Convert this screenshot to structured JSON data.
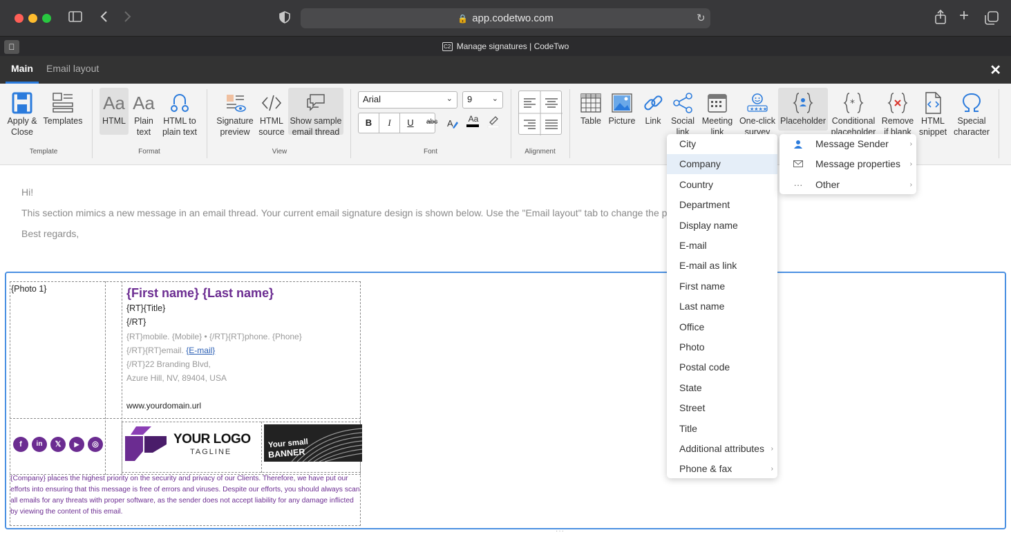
{
  "browser": {
    "url": "app.codetwo.com",
    "tab_title": "Manage signatures | CodeTwo",
    "tab_favicon": "C2"
  },
  "app_tabs": [
    "Main",
    "Email layout"
  ],
  "ribbon": {
    "template": {
      "label": "Template",
      "apply_close": "Apply &\nClose",
      "templates": "Templates"
    },
    "format": {
      "label": "Format",
      "html": "HTML",
      "plain_text": "Plain\ntext",
      "html_to_plain": "HTML to\nplain text"
    },
    "view": {
      "label": "View",
      "signature_preview": "Signature\npreview",
      "html_source": "HTML\nsource",
      "show_sample": "Show sample\nemail thread"
    },
    "font": {
      "label": "Font",
      "family": "Arial",
      "size": "9",
      "bold": "B",
      "italic": "I",
      "underline": "U",
      "strike": "abc",
      "font_color_sample": "Aa"
    },
    "alignment": {
      "label": "Alignment"
    },
    "insert": {
      "table": "Table",
      "picture": "Picture",
      "link": "Link",
      "social_link": "Social\nlink",
      "meeting_link": "Meeting\nlink",
      "one_click_survey": "One-click\nsurvey",
      "placeholder": "Placeholder",
      "conditional_placeholder": "Conditional\nplaceholder",
      "remove_if_blank": "Remove\nif blank",
      "html_snippet": "HTML\nsnippet",
      "special_character": "Special\ncharacter"
    }
  },
  "message": {
    "greeting": "Hi!",
    "body": "This section mimics a new message in an email thread. Your current email signature design is shown below. Use the \"Email layout\" tab to change the po",
    "closing": "Best regards,"
  },
  "signature": {
    "photo": "{Photo 1}",
    "name": "{First name} {Last name}",
    "title": "{RT}{Title}",
    "rt_close": "{/RT}",
    "phones": "{RT}mobile. {Mobile} • {/RT}{RT}phone. {Phone}",
    "email_prefix": "{/RT}{RT}email. ",
    "email_link": "{E-mail}",
    "address1": "{/RT}22 Branding Blvd,",
    "address2": "Azure Hill, NV, 89404, USA",
    "website": "www.yourdomain.url",
    "logo_text": "YOUR LOGO",
    "logo_tagline": "TAGLINE",
    "banner_line1": "Your small",
    "banner_line2": "BANNER",
    "disclaimer": "{Company} places the highest priority on the security and privacy of our Clients. Therefore, we have put our efforts into ensuring that this message is free of errors and viruses. Despite our efforts, you should always scan all emails for any threats with proper software, as the sender does not accept liability for any damage inflicted by viewing the content of this email.",
    "social": [
      "f",
      "in",
      "𝕏",
      "▶",
      "◎"
    ],
    "brand_color": "#6b2c91"
  },
  "placeholder_menu": {
    "items": [
      "City",
      "Company",
      "Country",
      "Department",
      "Display name",
      "E-mail",
      "E-mail as link",
      "First name",
      "Last name",
      "Office",
      "Photo",
      "Postal code",
      "State",
      "Street",
      "Title",
      "Additional attributes",
      "Phone & fax"
    ],
    "highlighted": "Company",
    "submenu": [
      "Message Sender",
      "Message properties",
      "Other"
    ]
  }
}
